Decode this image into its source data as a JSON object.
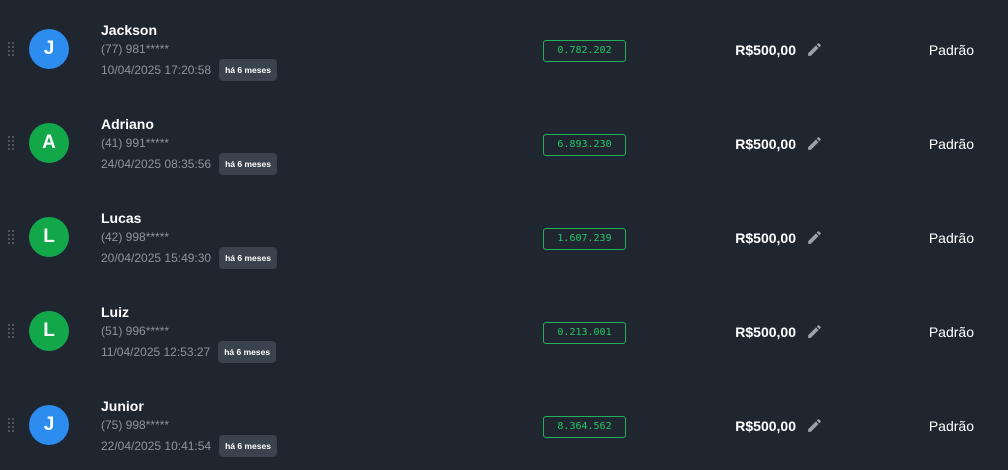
{
  "colors": {
    "background": "#1f2630",
    "avatar_blue": "#2d8cf0",
    "avatar_green": "#12a84a",
    "code_green": "#22c865",
    "badge_bg": "#3a424d"
  },
  "icons": {
    "drag": "drag-handle-icon",
    "edit": "pencil-icon"
  },
  "rows": [
    {
      "initial": "J",
      "avatar_color": "#2d8cf0",
      "name": "Jackson",
      "phone": "(77) 981*****",
      "datetime": "10/04/2025 17:20:58",
      "ago": "há 6 meses",
      "code": "0.782.202",
      "amount": "R$500,00",
      "type": "Padrão"
    },
    {
      "initial": "A",
      "avatar_color": "#12a84a",
      "name": "Adriano",
      "phone": "(41) 991*****",
      "datetime": "24/04/2025 08:35:56",
      "ago": "há 6 meses",
      "code": "6.893.230",
      "amount": "R$500,00",
      "type": "Padrão"
    },
    {
      "initial": "L",
      "avatar_color": "#12a84a",
      "name": "Lucas",
      "phone": "(42) 998*****",
      "datetime": "20/04/2025 15:49:30",
      "ago": "há 6 meses",
      "code": "1.607.239",
      "amount": "R$500,00",
      "type": "Padrão"
    },
    {
      "initial": "L",
      "avatar_color": "#12a84a",
      "name": "Luiz",
      "phone": "(51) 996*****",
      "datetime": "11/04/2025 12:53:27",
      "ago": "há 6 meses",
      "code": "0.213.001",
      "amount": "R$500,00",
      "type": "Padrão"
    },
    {
      "initial": "J",
      "avatar_color": "#2d8cf0",
      "name": "Junior",
      "phone": "(75) 998*****",
      "datetime": "22/04/2025 10:41:54",
      "ago": "há 6 meses",
      "code": "8.364.562",
      "amount": "R$500,00",
      "type": "Padrão"
    }
  ]
}
